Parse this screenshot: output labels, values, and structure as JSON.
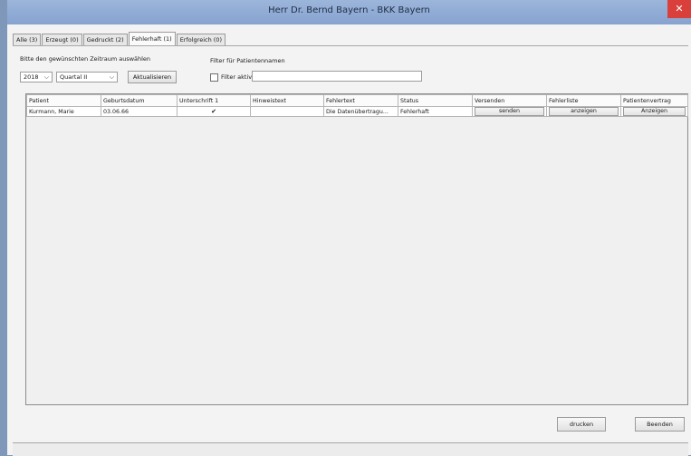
{
  "window": {
    "title": "Herr Dr. Bernd Bayern - BKK Bayern",
    "close_glyph": "✕"
  },
  "tabs": [
    {
      "label": "Alle (3)"
    },
    {
      "label": "Erzeugt (0)"
    },
    {
      "label": "Gedruckt (2)"
    },
    {
      "label": "Fehlerhaft (1)"
    },
    {
      "label": "Erfolgreich (0)"
    }
  ],
  "filters": {
    "period_label": "Bitte den gewünschten Zeitraum auswählen",
    "year_value": "2018",
    "quarter_value": "Quartal II",
    "refresh_label": "Aktualisieren",
    "patient_filter_label": "Filter für Patientennamen",
    "filter_active_label": "Filter aktiv",
    "filter_text": ""
  },
  "table": {
    "columns": [
      "Patient",
      "Geburtsdatum",
      "Unterschrift 1",
      "Hinweistext",
      "Fehlertext",
      "Status",
      "Versenden",
      "Fehlerliste",
      "Patientenvertrag"
    ],
    "rows": [
      {
        "patient": "Kurmann, Marie",
        "birthdate": "03.06.66",
        "signature_checked": "✔",
        "hint": "",
        "error_text": "Die Datenübertragu...",
        "status": "Fehlerhaft",
        "send_label": "senden",
        "errorlist_label": "anzeigen",
        "contract_label": "Anzeigen"
      }
    ]
  },
  "footer": {
    "print_label": "drucken",
    "exit_label": "Beenden"
  }
}
